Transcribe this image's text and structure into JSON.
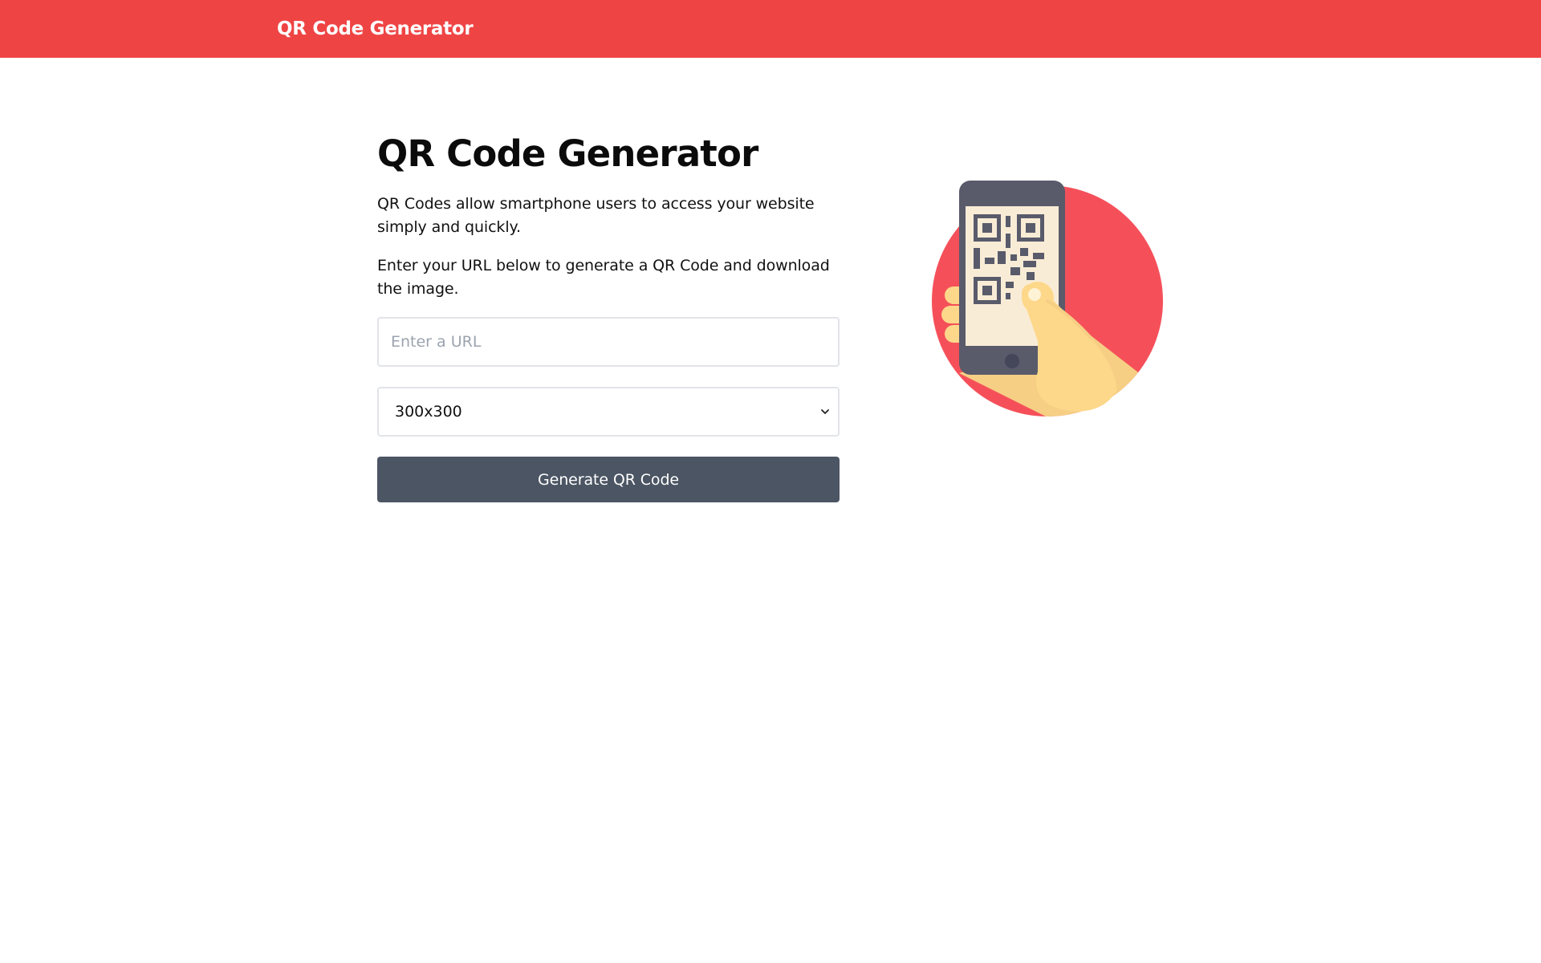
{
  "header": {
    "brand": "QR Code Generator"
  },
  "main": {
    "title": "QR Code Generator",
    "intro": "QR Codes allow smartphone users to access your website simply and quickly.",
    "instructions": "Enter your URL below to generate a QR Code and download the image.",
    "url_input": {
      "placeholder": "Enter a URL",
      "value": ""
    },
    "size_select": {
      "selected": "300x300"
    },
    "generate_button": "Generate QR Code"
  },
  "illustration": {
    "icon": "phone-qr-scan-icon"
  },
  "colors": {
    "brand": "#ef4444",
    "button": "#4b5563",
    "illustration_circle": "#f5505a",
    "phone": "#595b6b",
    "screen": "#f9ecd6",
    "hand": "#fdd88a"
  }
}
